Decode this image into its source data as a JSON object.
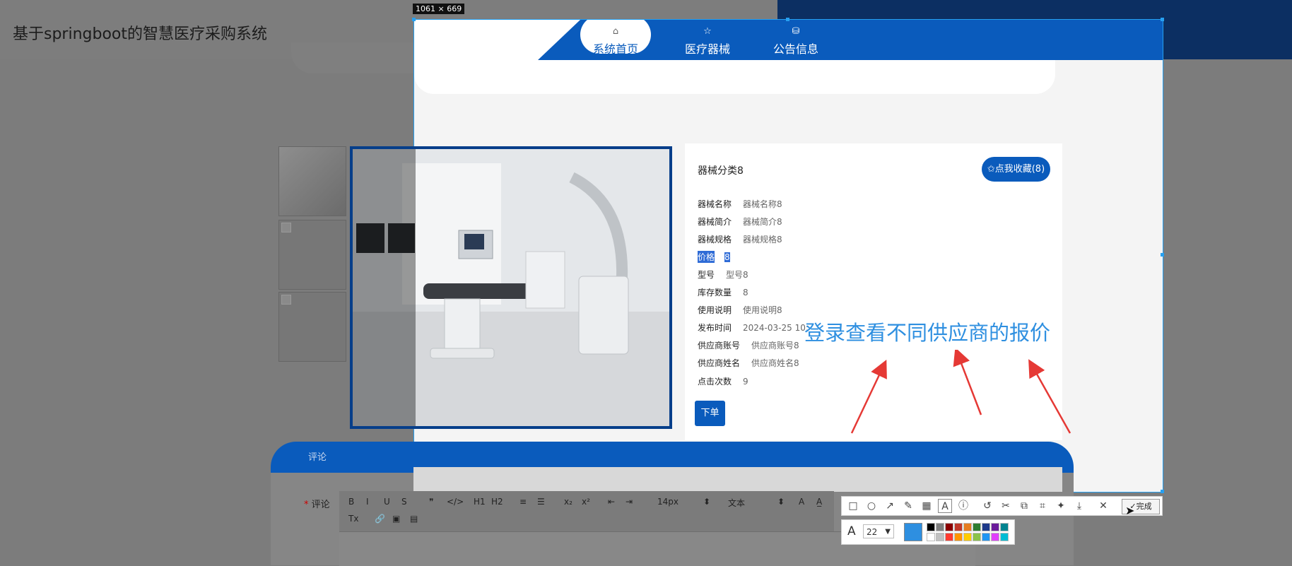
{
  "site": {
    "title": "基于springboot的智慧医疗采购系统"
  },
  "nav": [
    {
      "label": "系统首页",
      "icon": "home-icon"
    },
    {
      "label": "医疗器械",
      "icon": "star-icon"
    },
    {
      "label": "公告信息",
      "icon": "bag-icon"
    }
  ],
  "capture": {
    "dimensions": "1061 × 669"
  },
  "product": {
    "category": "器械分类8",
    "favorite_label": "✩点我收藏(8)",
    "fields": [
      {
        "key": "器械名称",
        "value": "器械名称8"
      },
      {
        "key": "器械简介",
        "value": "器械简介8"
      },
      {
        "key": "器械规格",
        "value": "器械规格8"
      },
      {
        "key": "价格",
        "value": "8",
        "selected": true
      },
      {
        "key": "型号",
        "value": "型号8"
      },
      {
        "key": "库存数量",
        "value": "8"
      },
      {
        "key": "使用说明",
        "value": "使用说明8"
      },
      {
        "key": "发布时间",
        "value": "2024-03-25 10:"
      },
      {
        "key": "供应商账号",
        "value": "供应商账号8"
      },
      {
        "key": "供应商姓名",
        "value": "供应商姓名8"
      },
      {
        "key": "点击次数",
        "value": "9"
      }
    ],
    "order_label": "下单"
  },
  "annotation": {
    "text": "登录查看不同供应商的报价",
    "color": "#2e8fe0"
  },
  "comments": {
    "tab_label": "评论",
    "editor_label": "评论",
    "required_mark": "*",
    "toolbar": [
      "B",
      "I",
      "U",
      "S",
      "❞",
      "</>",
      "H1",
      "H2",
      "≡",
      "☰",
      "x₂",
      "x²",
      "⇤",
      "⇥",
      "14px",
      "⬍",
      "文本",
      "⬍",
      "A",
      "A̲",
      "Tx",
      "🔗",
      "▣",
      "▤"
    ]
  },
  "screenshot_tool": {
    "tools": [
      "rect-icon",
      "circle-icon",
      "arrow-icon",
      "pen-icon",
      "mosaic-icon",
      "text-icon",
      "number-icon",
      "undo-icon",
      "crop-icon",
      "translate-icon",
      "ocr-icon",
      "pin-icon",
      "download-icon",
      "close-icon"
    ],
    "finish_label": "完成",
    "font_size": "22",
    "current_color": "#2e8fe0",
    "palette": [
      "#000000",
      "#808080",
      "#8b0000",
      "#c0392b",
      "#e67e22",
      "#2e7d32",
      "#1e3a8a",
      "#6a1b9a",
      "#00838f",
      "#ffffff",
      "#c0c0c0",
      "#ff3b30",
      "#ff9500",
      "#ffcc00",
      "#8bc34a",
      "#2196f3",
      "#e040fb",
      "#00bcd4"
    ]
  },
  "colors": {
    "brand_blue": "#0a5bbc",
    "header_dark": "#0c2f62",
    "selection_border": "#27a0f0"
  }
}
